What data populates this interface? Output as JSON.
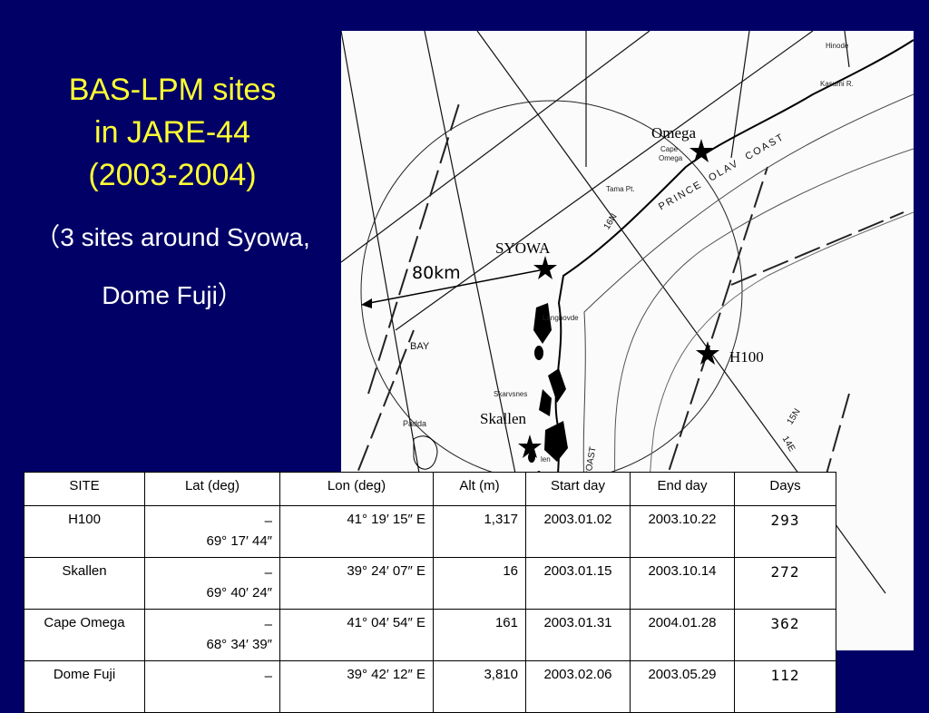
{
  "title": {
    "line1": "BAS-LPM sites",
    "line2": "in JARE-44",
    "line3": "(2003-2004)"
  },
  "subtitle": {
    "line1": "（3 sites around Syowa,",
    "line2": "Dome Fuji）"
  },
  "map": {
    "scale_label": "80km",
    "sites": {
      "omega": "Omega",
      "syowa": "SYOWA",
      "h100": "H100",
      "skallen": "Skallen"
    },
    "labels": {
      "cape_omega_1": "Cape",
      "cape_omega_2": "Omega",
      "tama": "Tama Pt.",
      "prince_olav": "PRINCE  OLAV  COAST",
      "langhovde": "Langhovde",
      "skarvsnes": "Skarvsnes",
      "bay": "BAY",
      "padda": "Padda",
      "len": "len",
      "kasumi": "Kasumi R.",
      "hinode": "Hinode",
      "lat16": "16N",
      "lat15": "15N",
      "lon14": "14E",
      "coast": "COAST"
    }
  },
  "table": {
    "headers": [
      "SITE",
      "Lat (deg)",
      "Lon (deg)",
      "Alt (m)",
      "Start day",
      "End day",
      "Days"
    ],
    "rows": [
      {
        "site": "H100",
        "lat1": "–",
        "lat2": "69° 17′ 44″",
        "lon": "41° 19′ 15″ E",
        "alt": "1,317",
        "start": "2003.01.02",
        "end": "2003.10.22",
        "days": "293"
      },
      {
        "site": "Skallen",
        "lat1": "–",
        "lat2": "69° 40′ 24″",
        "lon": "39° 24′ 07″ E",
        "alt": "16",
        "start": "2003.01.15",
        "end": "2003.10.14",
        "days": "272"
      },
      {
        "site": "Cape Omega",
        "lat1": "–",
        "lat2": "68° 34′ 39″",
        "lon": "41° 04′ 54″ E",
        "alt": "161",
        "start": "2003.01.31",
        "end": "2004.01.28",
        "days": "362"
      },
      {
        "site": "Dome Fuji",
        "lat1": "–",
        "lat2": "",
        "lon": "39° 42′ 12″ E",
        "alt": "3,810",
        "start": "2003.02.06",
        "end": "2003.05.29",
        "days": "112"
      }
    ]
  }
}
